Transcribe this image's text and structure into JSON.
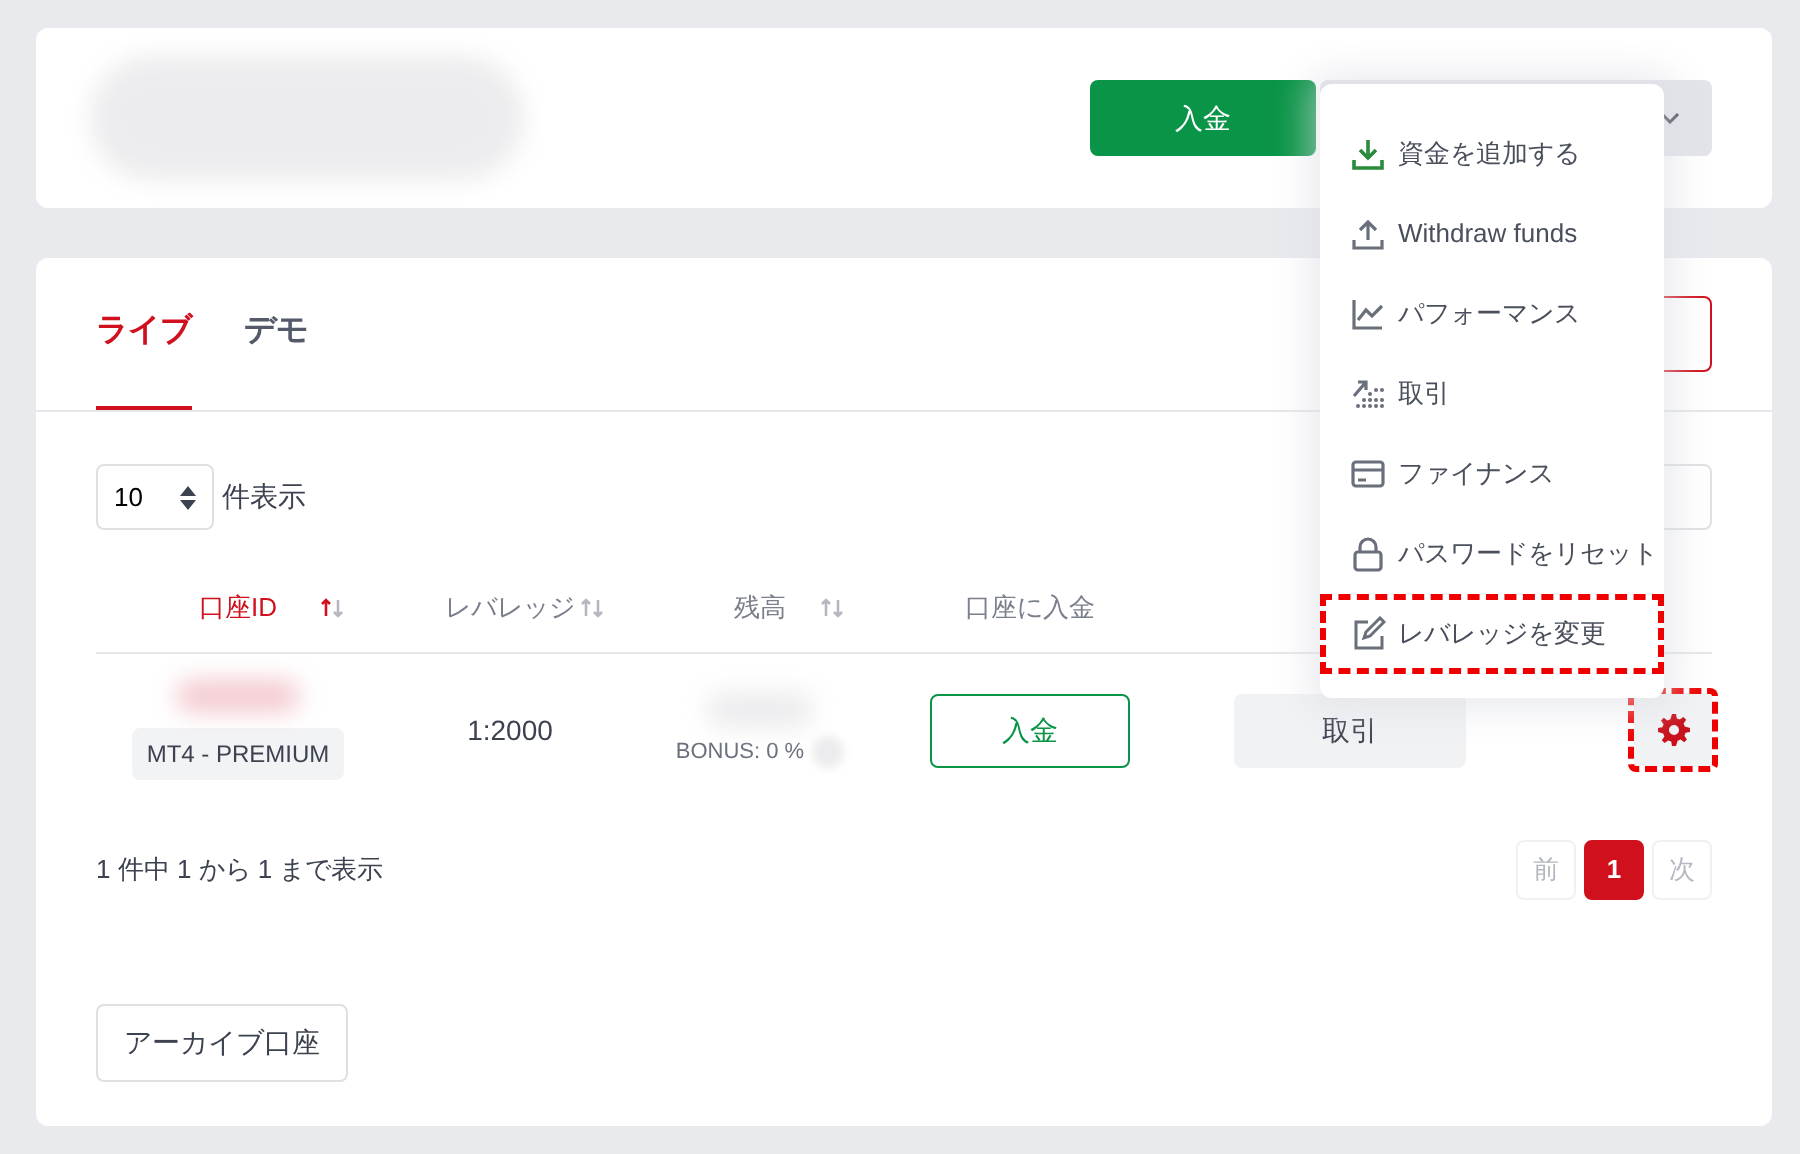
{
  "header": {
    "deposit_button": "入金"
  },
  "tabs": [
    {
      "label": "ライブ",
      "selected": true
    },
    {
      "label": "デモ",
      "selected": false
    }
  ],
  "page_length": {
    "value": "10",
    "suffix": "件表示"
  },
  "table": {
    "columns": [
      {
        "label": "口座ID",
        "sorted": true
      },
      {
        "label": "レバレッジ",
        "sorted": false
      },
      {
        "label": "残高",
        "sorted": false
      },
      {
        "label": "口座に入金"
      }
    ],
    "rows": [
      {
        "account_type": "MT4 - PREMIUM",
        "leverage": "1:2000",
        "bonus": "BONUS: 0 %",
        "deposit_button": "入金",
        "trade_button": "取引",
        "settings_highlighted": true
      }
    ]
  },
  "info": "1 件中 1 から 1 まで表示",
  "pagination": [
    {
      "label": "前",
      "selected": false,
      "disabled": true
    },
    {
      "label": "1",
      "selected": true,
      "disabled": false
    },
    {
      "label": "次",
      "selected": false,
      "disabled": true
    }
  ],
  "archive_button": "アーカイブ口座",
  "menu": {
    "items": [
      {
        "label": "資金を追加する",
        "kind": "download",
        "highlighted": false
      },
      {
        "label": "Withdraw funds",
        "kind": "upload",
        "highlighted": false
      },
      {
        "label": "パフォーマンス",
        "kind": "chart",
        "highlighted": false
      },
      {
        "label": "取引",
        "kind": "trade",
        "highlighted": false
      },
      {
        "label": "ファイナンス",
        "kind": "card",
        "highlighted": false
      },
      {
        "label": "パスワードをリセット",
        "kind": "lock",
        "highlighted": false
      },
      {
        "label": "レバレッジを変更",
        "kind": "edit",
        "highlighted": true
      }
    ]
  }
}
